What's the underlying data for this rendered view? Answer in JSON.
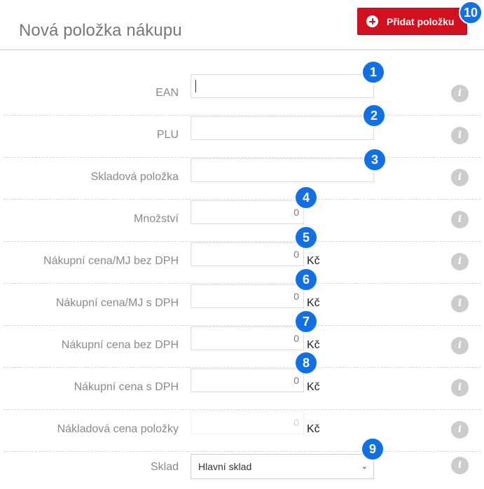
{
  "header": {
    "title": "Nová položka nákupu",
    "add_button_label": "Přidat položku"
  },
  "rows": [
    {
      "label": "EAN",
      "value": "",
      "badge": "1"
    },
    {
      "label": "PLU",
      "value": "",
      "badge": "2"
    },
    {
      "label": "Skladová položka",
      "value": "",
      "badge": "3"
    },
    {
      "label": "Množství",
      "value": "0",
      "badge": "4"
    },
    {
      "label": "Nákupní cena/MJ bez DPH",
      "value": "0",
      "unit": "Kč",
      "badge": "5"
    },
    {
      "label": "Nákupní cena/MJ s DPH",
      "value": "0",
      "unit": "Kč",
      "badge": "6"
    },
    {
      "label": "Nákupní cena bez DPH",
      "value": "0",
      "unit": "Kč",
      "badge": "7"
    },
    {
      "label": "Nákupní cena s DPH",
      "value": "0",
      "unit": "Kč",
      "badge": "8"
    },
    {
      "label": "Nákladová cena položky",
      "value": "0",
      "unit": "Kč"
    },
    {
      "label": "Sklad",
      "value": "Hlavní sklad",
      "badge": "9"
    }
  ],
  "header_badge": "10",
  "info_glyph": "i",
  "select_chevron": "⌄",
  "icons": [
    "plus-circle-icon",
    "info-icon",
    "chevron-down-icon"
  ],
  "colors": {
    "accent": "#d0101f",
    "badge": "#1270e6",
    "info": "#cccccc"
  }
}
